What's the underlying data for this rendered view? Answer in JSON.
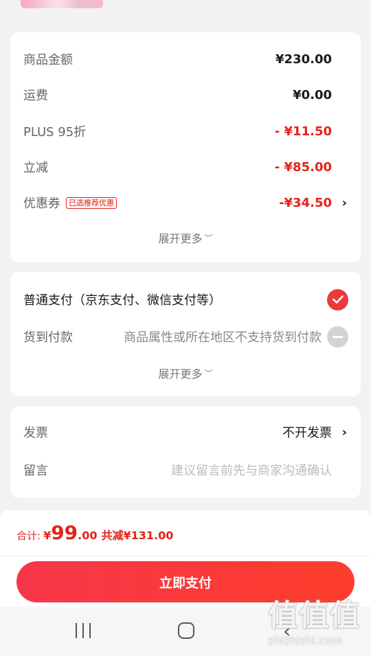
{
  "price_card": {
    "rows": [
      {
        "label": "商品金额",
        "value": "¥230.00"
      },
      {
        "label": "运费",
        "value": "¥0.00"
      },
      {
        "label": "PLUS 95折",
        "value": "- ¥11.50"
      },
      {
        "label": "立减",
        "value": "- ¥85.00"
      },
      {
        "label": "优惠券",
        "tag": "已选推荐优惠",
        "value": "-¥34.50"
      }
    ],
    "expand_label": "展开更多",
    "expand_symbol": "︶"
  },
  "payment_card": {
    "normal_label": "普通支付（京东支付、微信支付等）",
    "cod_label": "货到付款",
    "cod_note": "商品属性或所在地区不支持货到付款",
    "expand_label": "展开更多",
    "expand_symbol": "︶"
  },
  "extra_card": {
    "invoice_label": "发票",
    "invoice_value": "不开发票",
    "message_label": "留言",
    "message_placeholder": "建议留言前先与商家沟通确认"
  },
  "bottom_bar": {
    "total_label": "合计:",
    "currency": "¥",
    "total_int": "99",
    "total_dec": ".00",
    "saved_text": "共减¥131.00",
    "pay_button": "立即支付"
  },
  "navbar": {
    "back_glyph": "‹"
  },
  "watermark": {
    "text": "值值值",
    "url": "zhizhizhi.com"
  },
  "colors": {
    "accent": "#e2231a",
    "button_gradient_start": "#f7364a",
    "button_gradient_end": "#fd3d2b"
  },
  "icons": {
    "chevron": "chevron-right-icon",
    "selected": "check-circle-icon",
    "disabled": "minus-circle-icon"
  }
}
